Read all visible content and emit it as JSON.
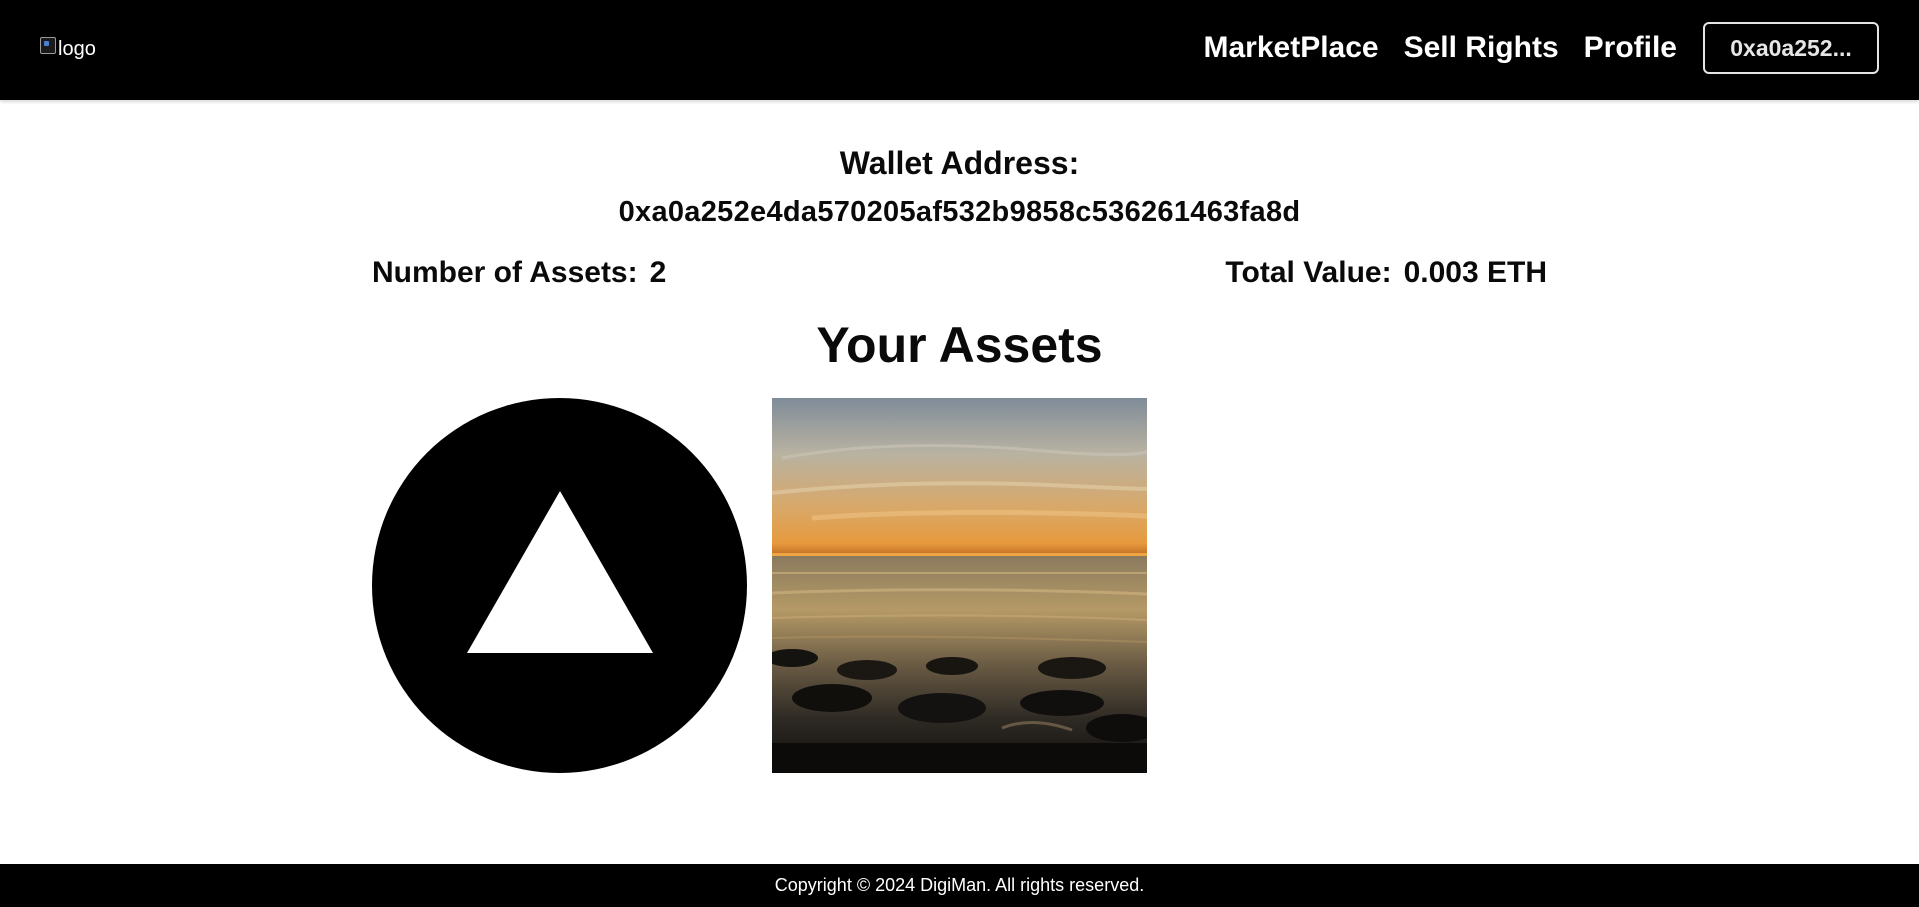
{
  "navbar": {
    "logo_alt": "logo",
    "links": [
      "MarketPlace",
      "Sell Rights",
      "Profile"
    ],
    "wallet_button": "0xa0a252..."
  },
  "profile": {
    "wallet_label": "Wallet Address:",
    "wallet_address": "0xa0a252e4da570205af532b9858c536261463fa8d",
    "assets_count_label": "Number of Assets:",
    "assets_count": "2",
    "total_value_label": "Total Value:",
    "total_value": "0.003 ETH"
  },
  "assets": {
    "heading": "Your Assets",
    "items": [
      {
        "icon": "triangle-in-circle-icon"
      },
      {
        "icon": "sunset-seashore-image"
      }
    ]
  },
  "footer": {
    "copyright": "Copyright © 2024 DigiMan. All rights reserved."
  },
  "colors": {
    "navbar_bg": "#000000",
    "page_bg": "#ffffff",
    "text": "#0a0a0a"
  }
}
